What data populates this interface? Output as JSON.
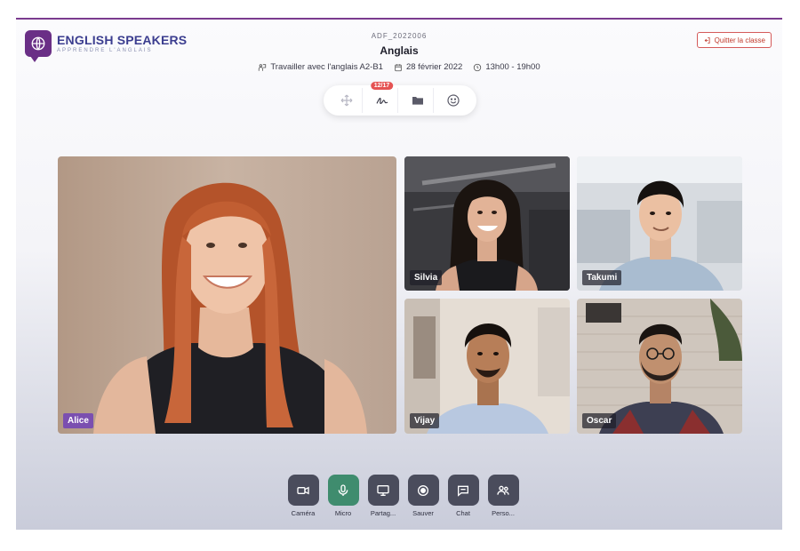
{
  "brand": {
    "name": "ENGLISH SPEAKERS",
    "tagline": "APPRENDRE L'ANGLAIS"
  },
  "session": {
    "code": "ADF_2022006",
    "subject": "Anglais",
    "course": "Travailler avec l'anglais A2-B1",
    "date": "28 février 2022",
    "time": "13h00 - 19h00"
  },
  "header": {
    "quit_label": "Quitter la classe"
  },
  "tools": [
    {
      "name": "move",
      "icon": "move-icon"
    },
    {
      "name": "signature",
      "icon": "signature-icon",
      "badge": "12/17"
    },
    {
      "name": "folder",
      "icon": "folder-icon"
    },
    {
      "name": "emoji",
      "icon": "smiley-icon"
    }
  ],
  "participants": [
    {
      "name": "Alice"
    },
    {
      "name": "Silvia"
    },
    {
      "name": "Takumi"
    },
    {
      "name": "Vijay"
    },
    {
      "name": "Oscar"
    }
  ],
  "controls": [
    {
      "label": "Caméra",
      "icon": "camera-icon"
    },
    {
      "label": "Micro",
      "icon": "microphone-icon",
      "active": true
    },
    {
      "label": "Partag...",
      "icon": "screen-share-icon"
    },
    {
      "label": "Sauver",
      "icon": "record-icon"
    },
    {
      "label": "Chat",
      "icon": "chat-icon"
    },
    {
      "label": "Perso...",
      "icon": "people-icon"
    }
  ],
  "colors": {
    "brand": "#6a2f86",
    "accent_tag": "#7b4fb0",
    "mic_active": "#3f8c6e",
    "control_bg": "#4a4c5c",
    "badge": "#e55353",
    "quit": "#c0392b"
  }
}
